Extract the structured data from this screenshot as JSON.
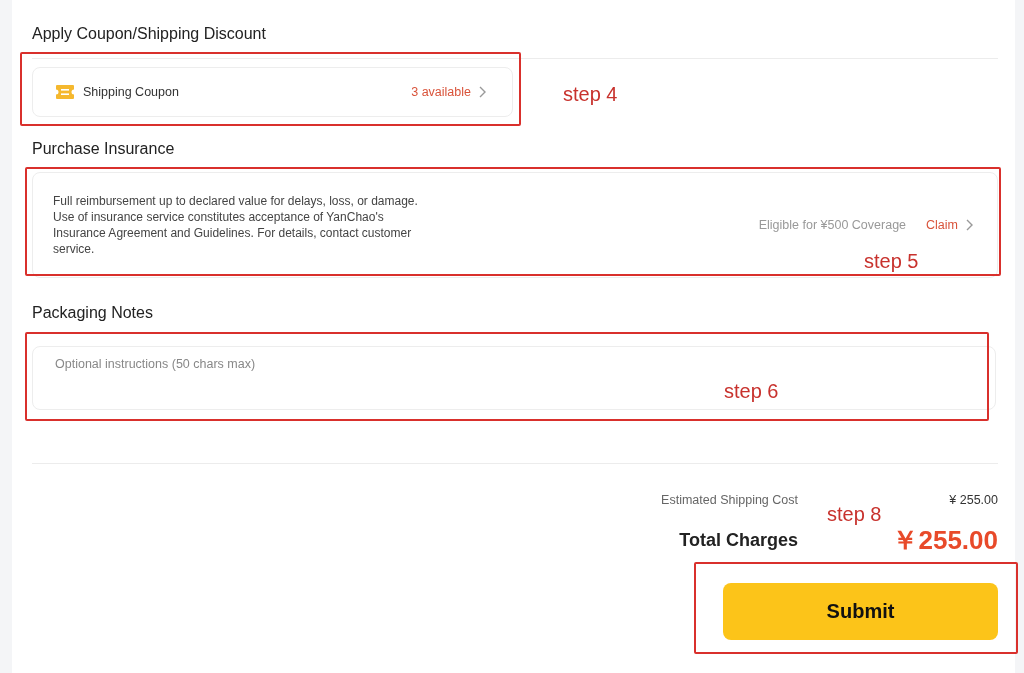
{
  "coupon_section": {
    "title": "Apply Coupon/Shipping Discount",
    "coupon": {
      "label": "Shipping Coupon",
      "count": "3 available"
    }
  },
  "insurance_section": {
    "title": "Purchase Insurance",
    "description": "Full reimbursement up to declared value for delays, loss, or damage. Use of insurance service constitutes acceptance of YanChao's Insurance Agreement and Guidelines. For details, contact customer service.",
    "coverage": "Eligible for ¥500 Coverage",
    "action": "Claim"
  },
  "notes_section": {
    "title": "Packaging Notes",
    "placeholder": "Optional instructions (50 chars max)"
  },
  "summary": {
    "shipping_label": "Estimated Shipping Cost",
    "shipping_value": "¥ 255.00",
    "total_label": "Total Charges",
    "total_value": "￥255.00"
  },
  "submit_button": "Submit",
  "annotations": [
    {
      "label": "step 4"
    },
    {
      "label": "step 5"
    },
    {
      "label": "step 6"
    },
    {
      "label": "step 8"
    }
  ]
}
